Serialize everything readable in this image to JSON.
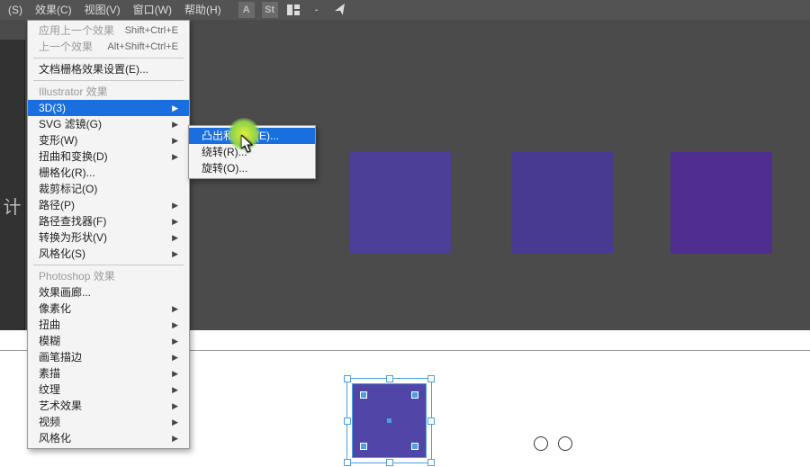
{
  "menubar": {
    "items": [
      "(S)",
      "效果(C)",
      "视图(V)",
      "窗口(W)",
      "帮助(H)"
    ],
    "icons": [
      "A",
      "St"
    ]
  },
  "menu": {
    "applyLast": {
      "label": "应用上一个效果",
      "accel": "Shift+Ctrl+E"
    },
    "last": {
      "label": "上一个效果",
      "accel": "Alt+Shift+Ctrl+E"
    },
    "docRaster": "文档栅格效果设置(E)...",
    "aiHeader": "Illustrator 效果",
    "ai": {
      "threeD": "3D(3)",
      "svg": "SVG 滤镜(G)",
      "warp": "变形(W)",
      "distort": "扭曲和变换(D)",
      "raster": "栅格化(R)...",
      "crop": "裁剪标记(O)",
      "path": "路径(P)",
      "pathfinder": "路径查找器(F)",
      "convert": "转换为形状(V)",
      "stylize": "风格化(S)"
    },
    "psHeader": "Photoshop 效果",
    "ps": {
      "gallery": "效果画廊...",
      "pixelate": "像素化",
      "distort": "扭曲",
      "blur": "模糊",
      "brush": "画笔描边",
      "sketch": "素描",
      "texture": "纹理",
      "artistic": "艺术效果",
      "video": "视频",
      "stylize": "风格化"
    }
  },
  "submenu": {
    "extrude": "凸出和斜角(E)...",
    "revolve": "绕转(R)...",
    "rotate": "旋转(O)..."
  },
  "swatches": {
    "colors": [
      "#4b3f97",
      "#493a91",
      "#4f2d91"
    ]
  },
  "sidebarGlyph": "计"
}
